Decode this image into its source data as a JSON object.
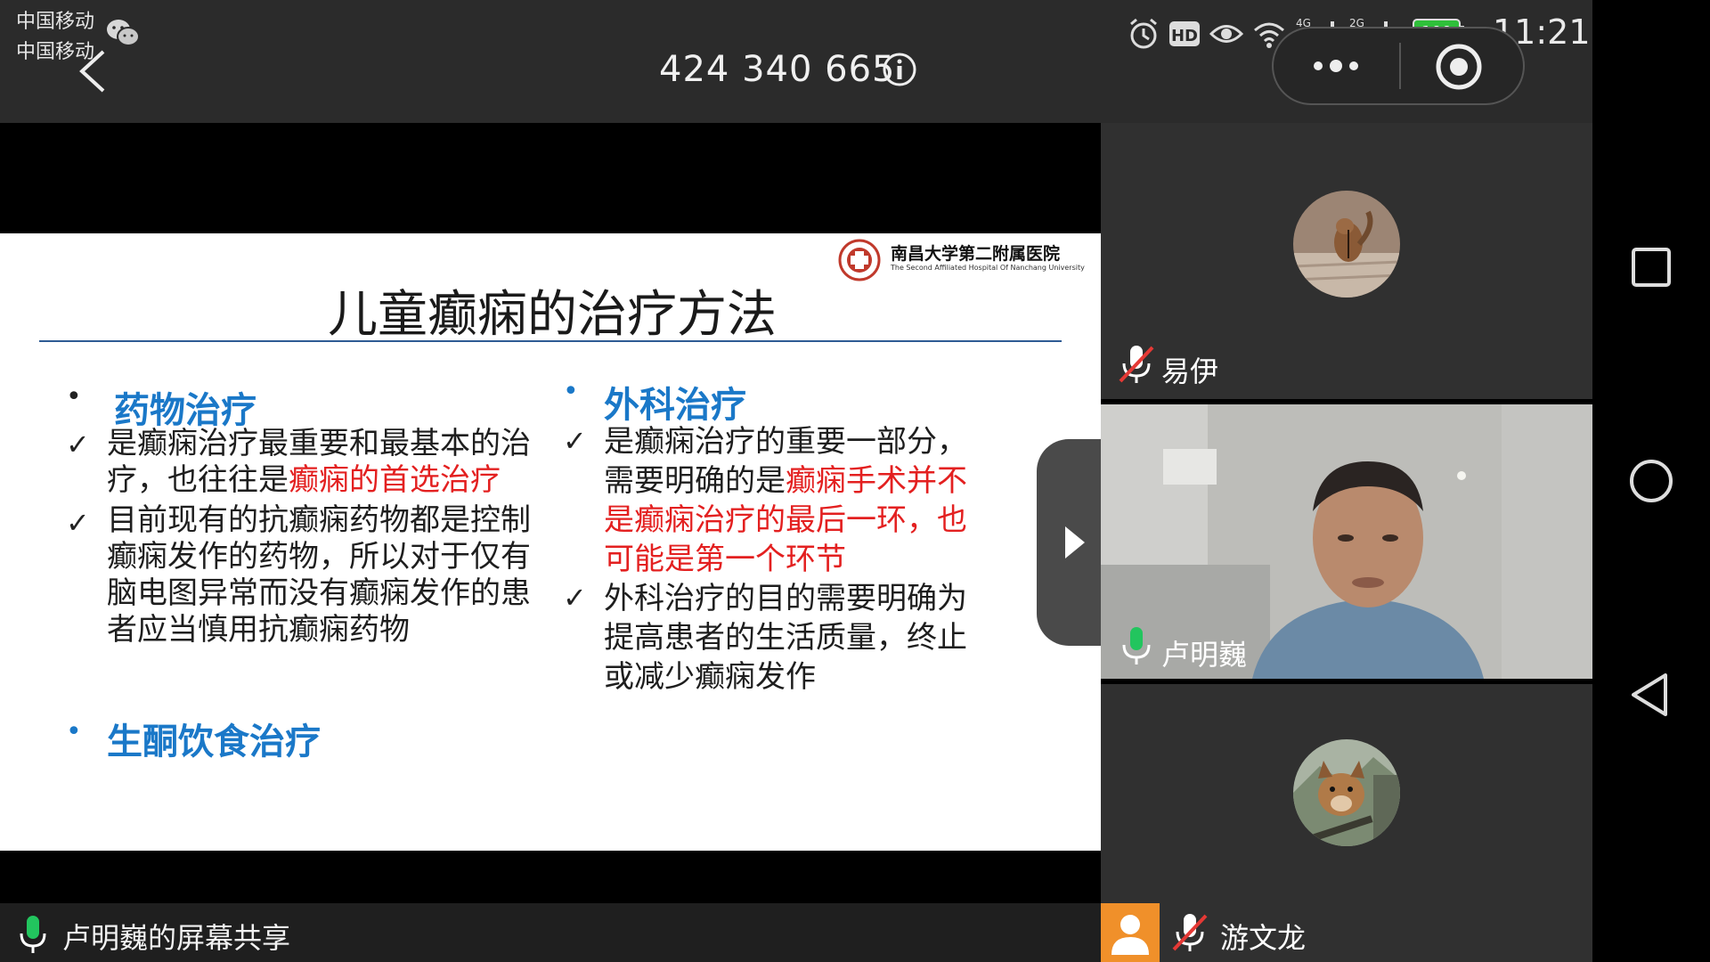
{
  "status_bar": {
    "carrier_1": "中国移动",
    "carrier_2": "中国移动",
    "time": "11:21",
    "battery": "100",
    "net_1": "4G",
    "net_2": "2G",
    "icons": [
      "wechat-icon",
      "alarm-icon",
      "hd-icon",
      "eye-icon",
      "wifi-icon",
      "signal-icon",
      "battery-icon"
    ]
  },
  "header": {
    "meeting_id": "424 340 665",
    "icons": [
      "back-icon",
      "info-icon",
      "more-icon",
      "record-icon"
    ]
  },
  "slide": {
    "hospital_name": "南昌大学第二附属医院",
    "hospital_name_en": "The Second Affiliated Hospital Of Nanchang University",
    "title": "儿童癫痫的治疗方法",
    "left": {
      "heading": "药物治疗",
      "item1_a": "是癫痫治疗最重要和最基本的治",
      "item1_b": "疗，也往往是",
      "item1_red": "癫痫的首选治疗",
      "item2_lines": [
        "目前现有的抗癫痫药物都是控制",
        "癫痫发作的药物，所以对于仅有",
        "脑电图异常而没有癫痫发作的患",
        "者应当慎用抗癫痫药物"
      ]
    },
    "right": {
      "heading": "外科治疗",
      "item1_a": "是癫痫治疗的重要一部分，",
      "item1_b": "需要明确的是",
      "item1_red_1": "癫痫手术并不",
      "item1_red_2": "是癫痫治疗的最后一环，也",
      "item1_red_3": "可能是第一个环节",
      "item2_lines": [
        "外科治疗的目的需要明确为",
        "提高患者的生活质量，终止",
        "或减少癫痫发作"
      ]
    },
    "bottom_heading": "生酮饮食治疗",
    "check_mark": "✓",
    "bullet_mark": "•"
  },
  "share_bar": {
    "label": "卢明巍的屏幕共享"
  },
  "participants": [
    {
      "name": "易伊",
      "mic": "muted"
    },
    {
      "name": "卢明巍",
      "mic": "active"
    },
    {
      "name": "游文龙",
      "mic": "muted"
    }
  ],
  "colors": {
    "accent_blue": "#1a78c8",
    "highlight_red": "#e32020",
    "mic_green": "#22c55e",
    "mute_red": "#e53935",
    "avatar_orange": "#f0902a"
  },
  "android_nav": [
    "recents-button",
    "home-button",
    "back-nav-button"
  ]
}
